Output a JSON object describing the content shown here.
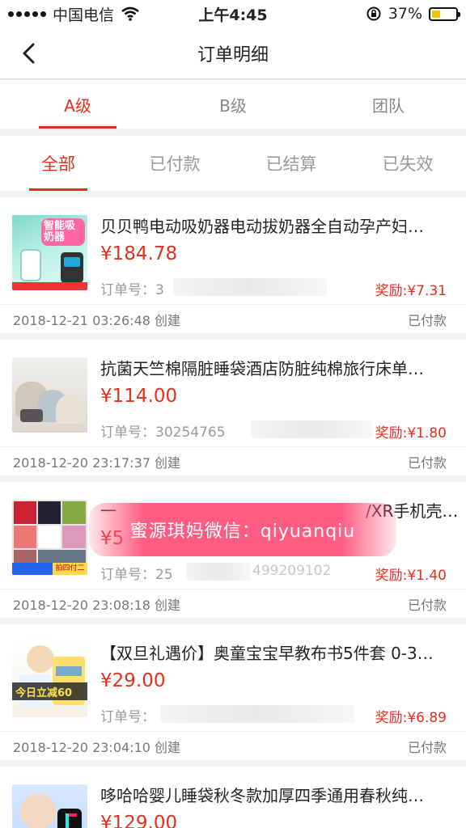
{
  "statusbar": {
    "carrier": "中国电信",
    "time": "上午4:45",
    "battery": "37%",
    "battery_level": 0.37
  },
  "nav": {
    "title": "订单明细"
  },
  "level_tabs": [
    {
      "label": "A级",
      "active": true
    },
    {
      "label": "B级",
      "active": false
    },
    {
      "label": "团队",
      "active": false
    }
  ],
  "status_tabs": [
    {
      "label": "全部",
      "active": true
    },
    {
      "label": "已付款",
      "active": false
    },
    {
      "label": "已结算",
      "active": false
    },
    {
      "label": "已失效",
      "active": false
    }
  ],
  "orders": [
    {
      "title": "贝贝鸭电动吸奶器电动拔奶器全自动孕产妇…",
      "price": "¥184.78",
      "order_no": "订单号：3",
      "reward": "奖励:¥7.31",
      "created": "2018-12-21 03:26:48 创建",
      "status": "已付款",
      "thumb_text": "智能吸奶器"
    },
    {
      "title": "抗菌天竺棉隔脏睡袋酒店防脏纯棉旅行床单…",
      "price": "¥114.00",
      "order_no": "订单号：30254765",
      "reward": "奖励:¥1.80",
      "created": "2018-12-20 23:17:37 创建",
      "status": "已付款",
      "thumb_text": ""
    },
    {
      "title": "一",
      "title_tail": "/XR手机壳…",
      "price": "¥5",
      "order_no": "订单号：25",
      "order_no_tail": "499209102",
      "reward": "奖励:¥1.40",
      "created": "2018-12-20 23:08:18 创建",
      "status": "已付款",
      "thumb_text": "拍四付二"
    },
    {
      "title": "【双旦礼遇价】奥童宝宝早教布书5件套 0-3…",
      "price": "¥29.00",
      "order_no": "订单号：",
      "reward": "奖励:¥6.89",
      "created": "2018-12-20 23:04:10 创建",
      "status": "已付款",
      "thumb_text": "今日立减60"
    },
    {
      "title": "哆哈哈婴儿睡袋秋冬款加厚四季通用春秋纯…",
      "price": "¥129.00"
    }
  ],
  "watermark": "蜜源琪妈微信：qiyuanqiu",
  "colors": {
    "accent": "#e0301e",
    "watermark": "#ff5c82"
  }
}
